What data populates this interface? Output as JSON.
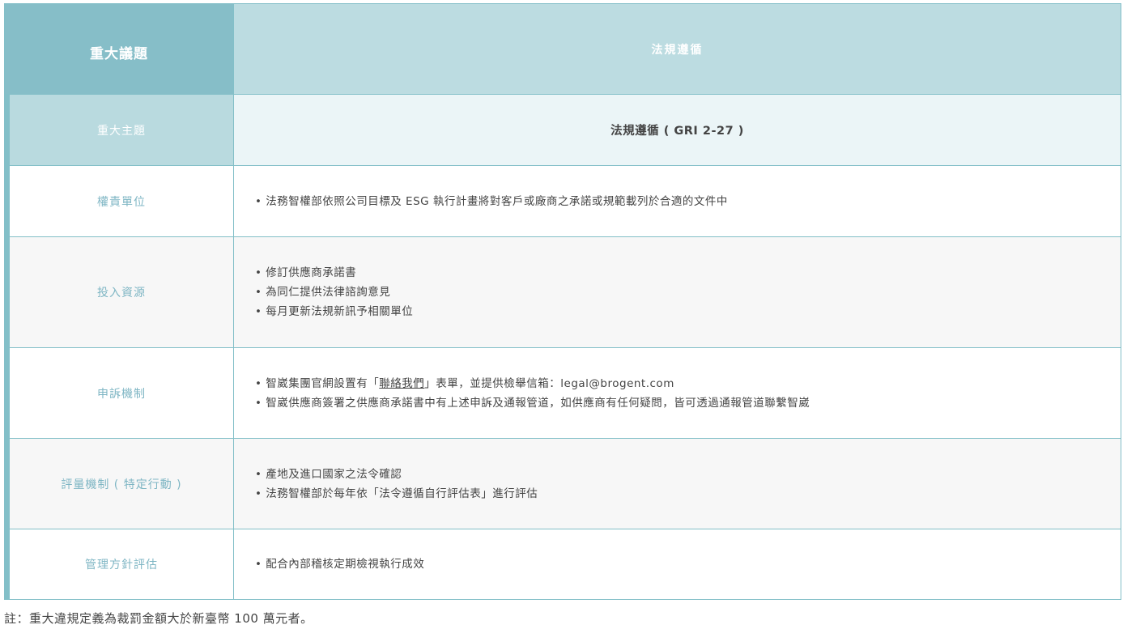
{
  "header": {
    "left": "重大議題",
    "right": "法規遵循"
  },
  "theme": {
    "label": "重大主題",
    "value": "法規遵循 ( GRI 2-27 )"
  },
  "responsibility": {
    "label": "權責單位",
    "items": [
      "• 法務智權部依照公司目標及 ESG 執行計畫將對客戶或廠商之承諾或規範載列於合適的文件中"
    ]
  },
  "resources": {
    "label": "投入資源",
    "items": [
      "• 修訂供應商承諾書",
      "• 為同仁提供法律諮詢意見",
      "• 每月更新法規新訊予相關單位"
    ]
  },
  "grievance": {
    "label": "申訴機制",
    "item1_prefix": "• 智崴集團官網設置有「",
    "item1_link": "聯絡我們",
    "item1_suffix": "」表單，並提供檢舉信箱：legal@brogent.com",
    "item2": "• 智崴供應商簽署之供應商承諾書中有上述申訴及通報管道，如供應商有任何疑問，皆可透過通報管道聯繫智崴"
  },
  "evaluation": {
    "label": "評量機制 ( 特定行動 )",
    "items": [
      "• 產地及進口國家之法令確認",
      "• 法務智權部於每年依「法令遵循自行評估表」進行評估"
    ]
  },
  "management": {
    "label": "管理方針評估",
    "items": [
      "• 配合內部稽核定期檢視執行成效"
    ]
  },
  "footnote": "註：重大違規定義為裁罰金額大於新臺幣 100 萬元者。"
}
